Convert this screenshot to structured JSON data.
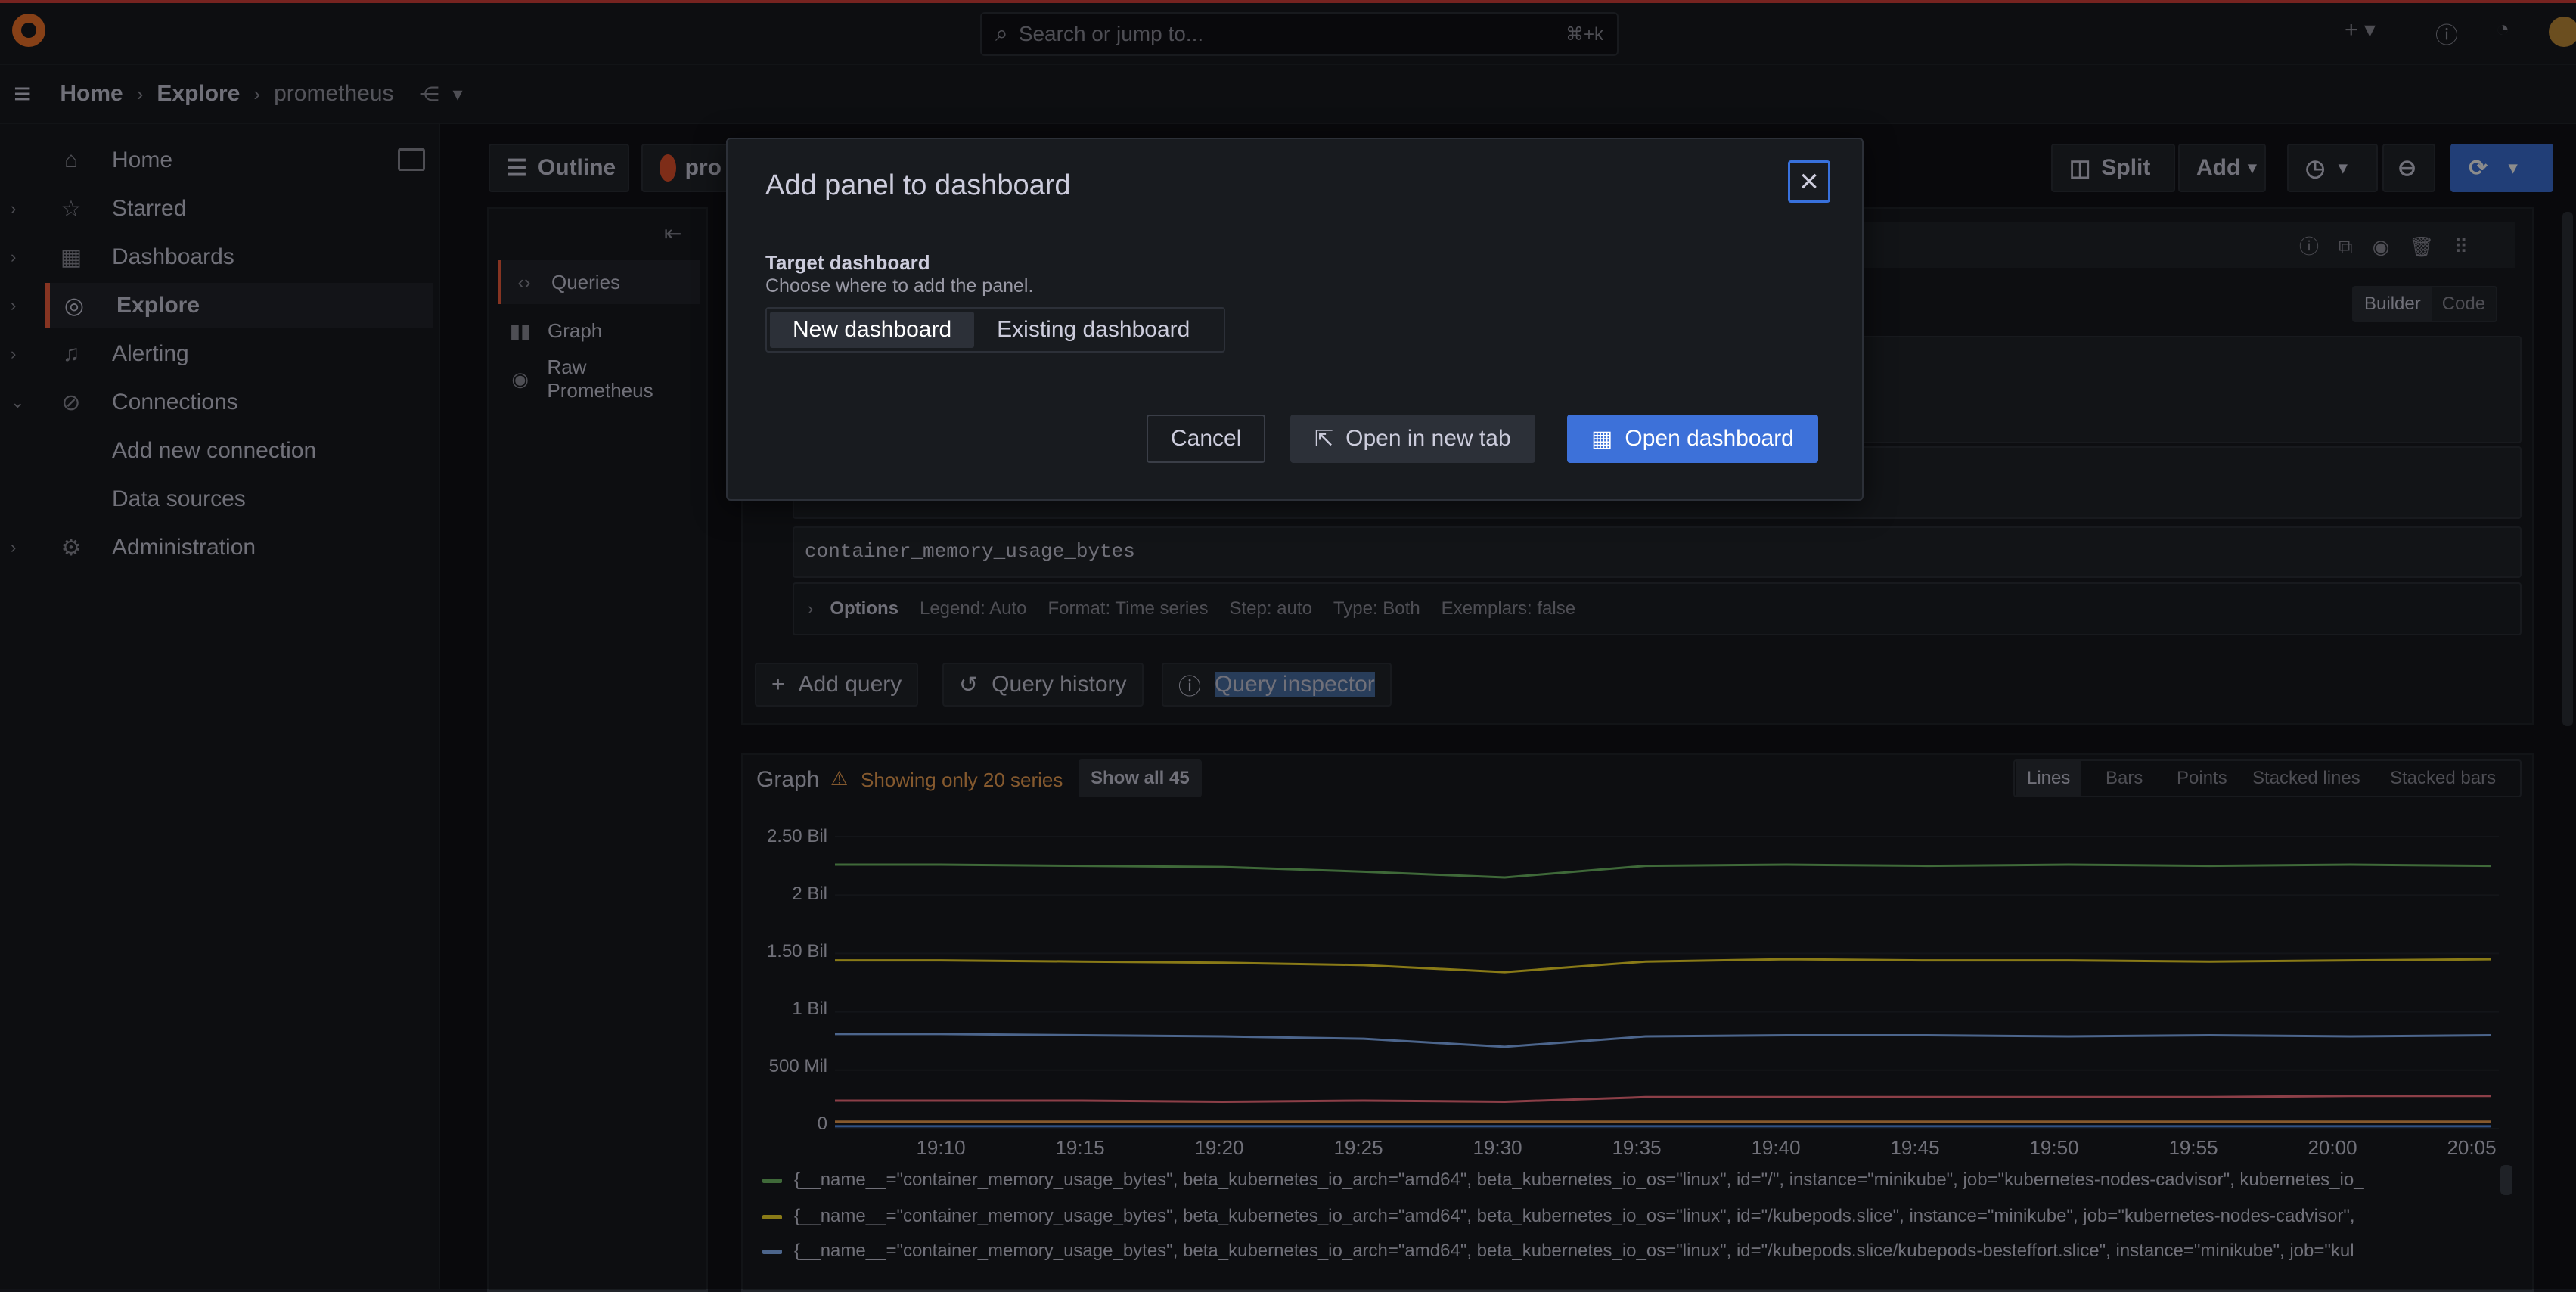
{
  "topbar": {
    "search_placeholder": "Search or jump to...",
    "search_shortcut": "⌘+k"
  },
  "breadcrumb": {
    "home": "Home",
    "explore": "Explore",
    "datasource": "prometheus"
  },
  "sidebar": {
    "items": [
      {
        "label": "Home"
      },
      {
        "label": "Starred"
      },
      {
        "label": "Dashboards"
      },
      {
        "label": "Explore"
      },
      {
        "label": "Alerting"
      },
      {
        "label": "Connections"
      },
      {
        "label": "Add new connection"
      },
      {
        "label": "Data sources"
      },
      {
        "label": "Administration"
      }
    ]
  },
  "toolbar": {
    "outline": "Outline",
    "datasource_short": "pro",
    "split": "Split",
    "add": "Add"
  },
  "outline": {
    "items": [
      {
        "label": "Queries"
      },
      {
        "label": "Graph"
      },
      {
        "label": "Raw Prometheus"
      }
    ]
  },
  "query": {
    "mode_builder": "Builder",
    "mode_code": "Code",
    "expression": "container_memory_usage_bytes",
    "options_label": "Options",
    "options_summary": [
      "Legend: Auto",
      "Format: Time series",
      "Step: auto",
      "Type: Both",
      "Exemplars: false"
    ],
    "add_query": "Add query",
    "query_history": "Query history",
    "query_inspector": "Query inspector"
  },
  "graph": {
    "title": "Graph",
    "warning": "Showing only 20 series",
    "show_all": "Show all 45",
    "view_types": [
      "Lines",
      "Bars",
      "Points",
      "Stacked lines",
      "Stacked bars"
    ],
    "selected_view": "Lines"
  },
  "chart_data": {
    "type": "line",
    "x": [
      "19:10",
      "19:15",
      "19:20",
      "19:25",
      "19:30",
      "19:35",
      "19:40",
      "19:45",
      "19:50",
      "19:55",
      "20:00",
      "20:05"
    ],
    "yticks": [
      "0",
      "500 Mil",
      "1 Bil",
      "1.50 Bil",
      "2 Bil",
      "2.50 Bil"
    ],
    "ylim": [
      0,
      2500000000
    ],
    "series": [
      {
        "color": "#73bf69",
        "values": [
          2260000000,
          2250000000,
          2240000000,
          2200000000,
          2150000000,
          2250000000,
          2260000000,
          2250000000,
          2260000000,
          2250000000,
          2260000000,
          2250000000
        ]
      },
      {
        "color": "#fade2a",
        "values": [
          1440000000,
          1430000000,
          1420000000,
          1400000000,
          1340000000,
          1430000000,
          1450000000,
          1440000000,
          1440000000,
          1430000000,
          1440000000,
          1450000000
        ]
      },
      {
        "color": "#8ab8ff",
        "values": [
          810000000,
          800000000,
          790000000,
          770000000,
          700000000,
          790000000,
          800000000,
          800000000,
          790000000,
          800000000,
          790000000,
          800000000
        ]
      },
      {
        "color": "#ff7383",
        "values": [
          240000000,
          240000000,
          230000000,
          240000000,
          230000000,
          270000000,
          270000000,
          270000000,
          270000000,
          270000000,
          280000000,
          280000000
        ]
      },
      {
        "color": "#f2a354",
        "values": [
          60000000,
          60000000,
          60000000,
          60000000,
          60000000,
          60000000,
          60000000,
          60000000,
          60000000,
          60000000,
          60000000,
          60000000
        ]
      },
      {
        "color": "#5794f2",
        "values": [
          20000000,
          20000000,
          20000000,
          20000000,
          20000000,
          20000000,
          20000000,
          20000000,
          20000000,
          20000000,
          20000000,
          20000000
        ]
      }
    ]
  },
  "legend": [
    {
      "color": "#73bf69",
      "text": "{__name__=\"container_memory_usage_bytes\", beta_kubernetes_io_arch=\"amd64\", beta_kubernetes_io_os=\"linux\", id=\"/\", instance=\"minikube\", job=\"kubernetes-nodes-cadvisor\", kubernetes_io_"
    },
    {
      "color": "#fade2a",
      "text": "{__name__=\"container_memory_usage_bytes\", beta_kubernetes_io_arch=\"amd64\", beta_kubernetes_io_os=\"linux\", id=\"/kubepods.slice\", instance=\"minikube\", job=\"kubernetes-nodes-cadvisor\","
    },
    {
      "color": "#8ab8ff",
      "text": "{__name__=\"container_memory_usage_bytes\", beta_kubernetes_io_arch=\"amd64\", beta_kubernetes_io_os=\"linux\", id=\"/kubepods.slice/kubepods-besteffort.slice\", instance=\"minikube\", job=\"kul"
    }
  ],
  "modal": {
    "title": "Add panel to dashboard",
    "target_label": "Target dashboard",
    "target_desc": "Choose where to add the panel.",
    "option_new": "New dashboard",
    "option_existing": "Existing dashboard",
    "cancel": "Cancel",
    "open_new_tab": "Open in new tab",
    "open_dashboard": "Open dashboard"
  }
}
